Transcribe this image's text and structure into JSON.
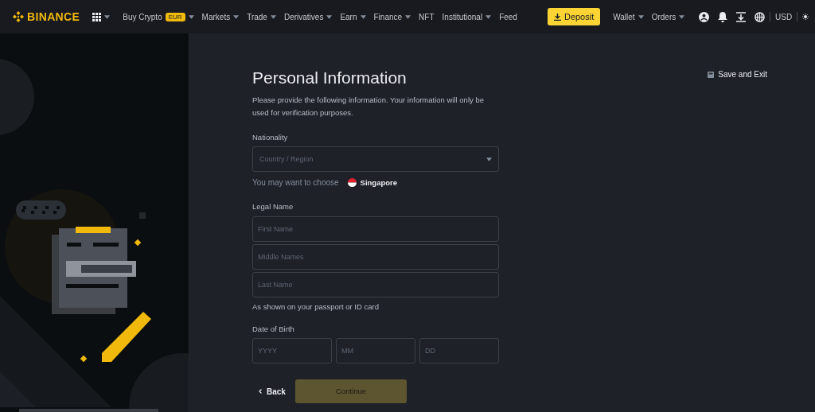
{
  "nav": {
    "brand": "BINANCE",
    "items": [
      {
        "label": "Buy Crypto",
        "badge": "EUR",
        "has_menu": true
      },
      {
        "label": "Markets",
        "has_menu": true
      },
      {
        "label": "Trade",
        "has_menu": true
      },
      {
        "label": "Derivatives",
        "has_menu": true
      },
      {
        "label": "Earn",
        "has_menu": true
      },
      {
        "label": "Finance",
        "has_menu": true
      },
      {
        "label": "NFT",
        "has_menu": false
      },
      {
        "label": "Institutional",
        "has_menu": true
      },
      {
        "label": "Feed",
        "has_menu": false
      }
    ],
    "deposit": "Deposit",
    "right_items": [
      {
        "label": "Wallet",
        "has_menu": true
      },
      {
        "label": "Orders",
        "has_menu": true
      }
    ],
    "currency": "USD"
  },
  "save_exit": "Save and Exit",
  "form": {
    "title": "Personal Information",
    "intro": "Please provide the following information. Your information will only be used for verification purposes.",
    "nationality": {
      "label": "Nationality",
      "placeholder": "Country / Region",
      "suggest_text": "You may want to choose",
      "suggestion": "Singapore"
    },
    "legal_name": {
      "label": "Legal Name",
      "fields": [
        {
          "placeholder": "First Name"
        },
        {
          "placeholder": "Middle Names"
        },
        {
          "placeholder": "Last Name"
        }
      ],
      "hint": "As shown on your passport or ID card"
    },
    "dob": {
      "label": "Date of Birth",
      "fields": [
        {
          "placeholder": "YYYY"
        },
        {
          "placeholder": "MM"
        },
        {
          "placeholder": "DD"
        }
      ]
    },
    "back": "Back",
    "continue": {
      "label": "Continue",
      "disabled": true
    }
  }
}
